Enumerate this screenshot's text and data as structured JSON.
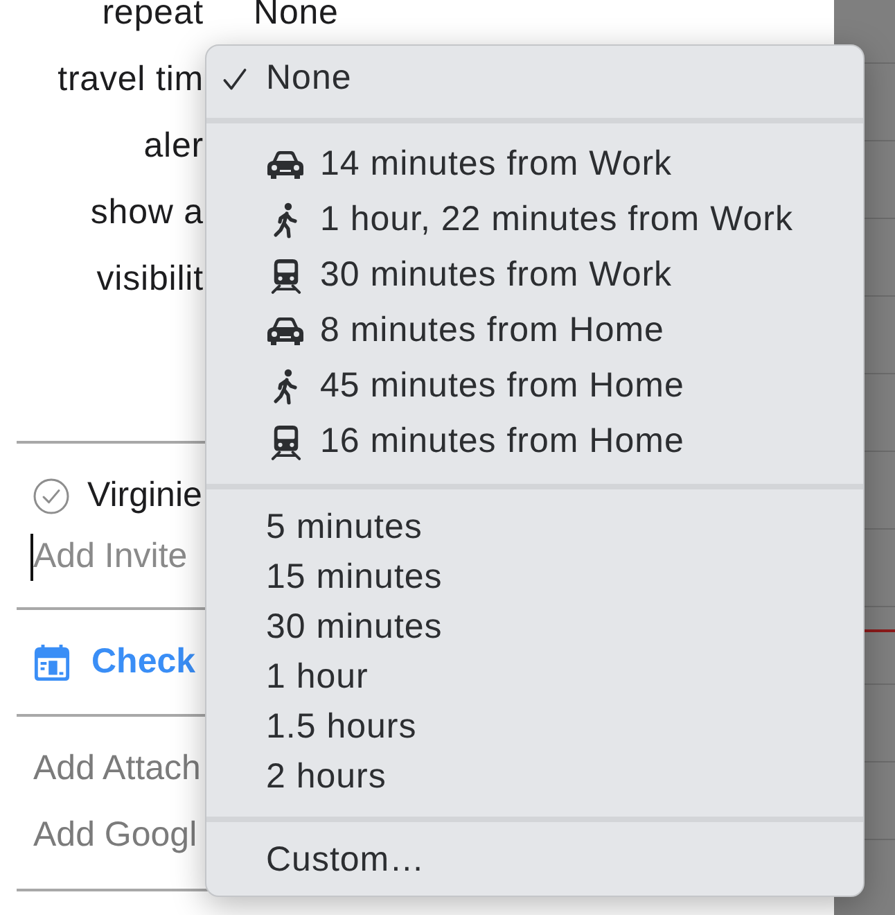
{
  "form": {
    "rows": [
      {
        "label": "repeat",
        "value": "None"
      },
      {
        "label": "travel tim"
      },
      {
        "label": "aler"
      },
      {
        "label": "show a"
      },
      {
        "label": "visibilit"
      }
    ]
  },
  "invitees": {
    "people": [
      {
        "name": "Virginie"
      }
    ],
    "field": {
      "placeholder": "Add Invite"
    }
  },
  "availability": {
    "label": "Check"
  },
  "actions": [
    "Add Attach",
    "Add Googl"
  ],
  "travel_time_menu": {
    "sections": [
      {
        "items": [
          {
            "kind": "plain",
            "label": "None",
            "selected": true
          }
        ]
      },
      {
        "items": [
          {
            "kind": "car",
            "label": "14 minutes from Work",
            "selected": false
          },
          {
            "kind": "walk",
            "label": "1 hour, 22 minutes from Work",
            "selected": false
          },
          {
            "kind": "train",
            "label": "30 minutes from Work",
            "selected": false
          },
          {
            "kind": "car",
            "label": "8 minutes from Home",
            "selected": false
          },
          {
            "kind": "walk",
            "label": "45 minutes from Home",
            "selected": false
          },
          {
            "kind": "train",
            "label": "16 minutes from Home",
            "selected": false
          }
        ]
      },
      {
        "items": [
          {
            "kind": "plain",
            "label": "5 minutes",
            "selected": false
          },
          {
            "kind": "plain",
            "label": "15 minutes",
            "selected": false
          },
          {
            "kind": "plain",
            "label": "30 minutes",
            "selected": false
          },
          {
            "kind": "plain",
            "label": "1 hour",
            "selected": false
          },
          {
            "kind": "plain",
            "label": "1.5 hours",
            "selected": false
          },
          {
            "kind": "plain",
            "label": "2 hours",
            "selected": false
          }
        ]
      },
      {
        "items": [
          {
            "kind": "plain",
            "label": "Custom…",
            "selected": false
          }
        ]
      }
    ]
  }
}
